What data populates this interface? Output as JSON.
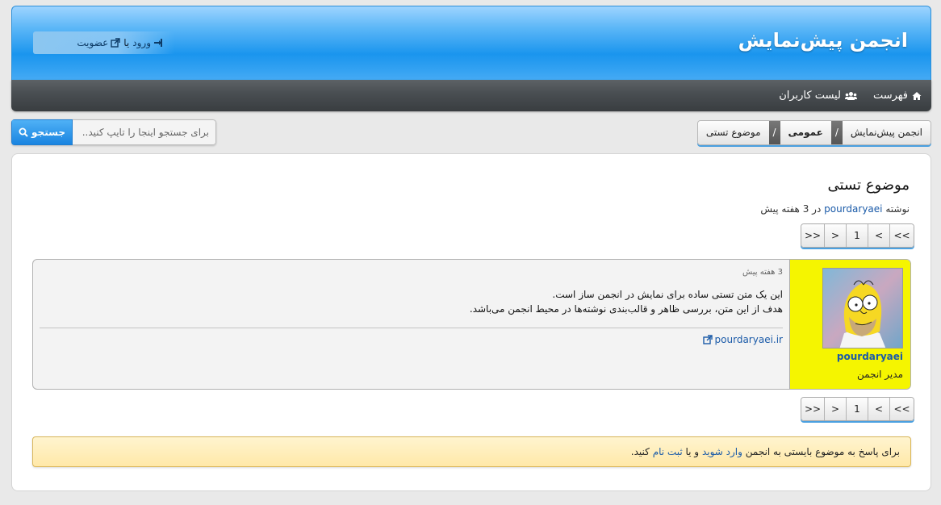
{
  "header": {
    "site_title": "انجمن پیش‌نمایش",
    "login_label": "ورود",
    "or_text": "یا",
    "register_label": "عضویت"
  },
  "nav": {
    "items": [
      {
        "label": "فهرست",
        "icon": "home-icon"
      },
      {
        "label": "لیست کاربران",
        "icon": "users-icon"
      }
    ]
  },
  "breadcrumb": {
    "items": [
      "انجمن پیش‌نمایش",
      "عمومی",
      "موضوع تستی"
    ],
    "separator": "/"
  },
  "search": {
    "placeholder": "برای جستجو اینجا را تایپ کنید..",
    "button_label": "جستجو"
  },
  "topic": {
    "title": "موضوع تستی",
    "byline_prefix": "نوشته",
    "author": "pourdaryaei",
    "byline_mid": "در",
    "byline_time": "3 هفته پیش"
  },
  "pagination": {
    "buttons": [
      "<<",
      "<",
      "1",
      ">",
      ">>"
    ]
  },
  "post": {
    "time": "3 هفته پیش",
    "lines": [
      "این یک متن تستی ساده برای نمایش در انجمن ساز است.",
      "هدف از این متن، بررسی ظاهر و قالب‌بندی نوشته‌ها در محیط انجمن می‌باشد."
    ],
    "signature_link": "pourdaryaei.ir",
    "author_name": "pourdaryaei",
    "author_role": "مدیر انجمن",
    "author_panel_color": "#f5f500"
  },
  "notice": {
    "prefix": "برای پاسخ به موضوع بایستی به انجمن",
    "login_link": "وارد شوید",
    "mid": "و یا",
    "register_link": "ثبت نام",
    "suffix": "کنید."
  },
  "colors": {
    "accent": "#1a95ee",
    "nav_bg": "#4a4f53",
    "link": "#1a5aa8",
    "notice_bg": "#ffe8a8"
  }
}
